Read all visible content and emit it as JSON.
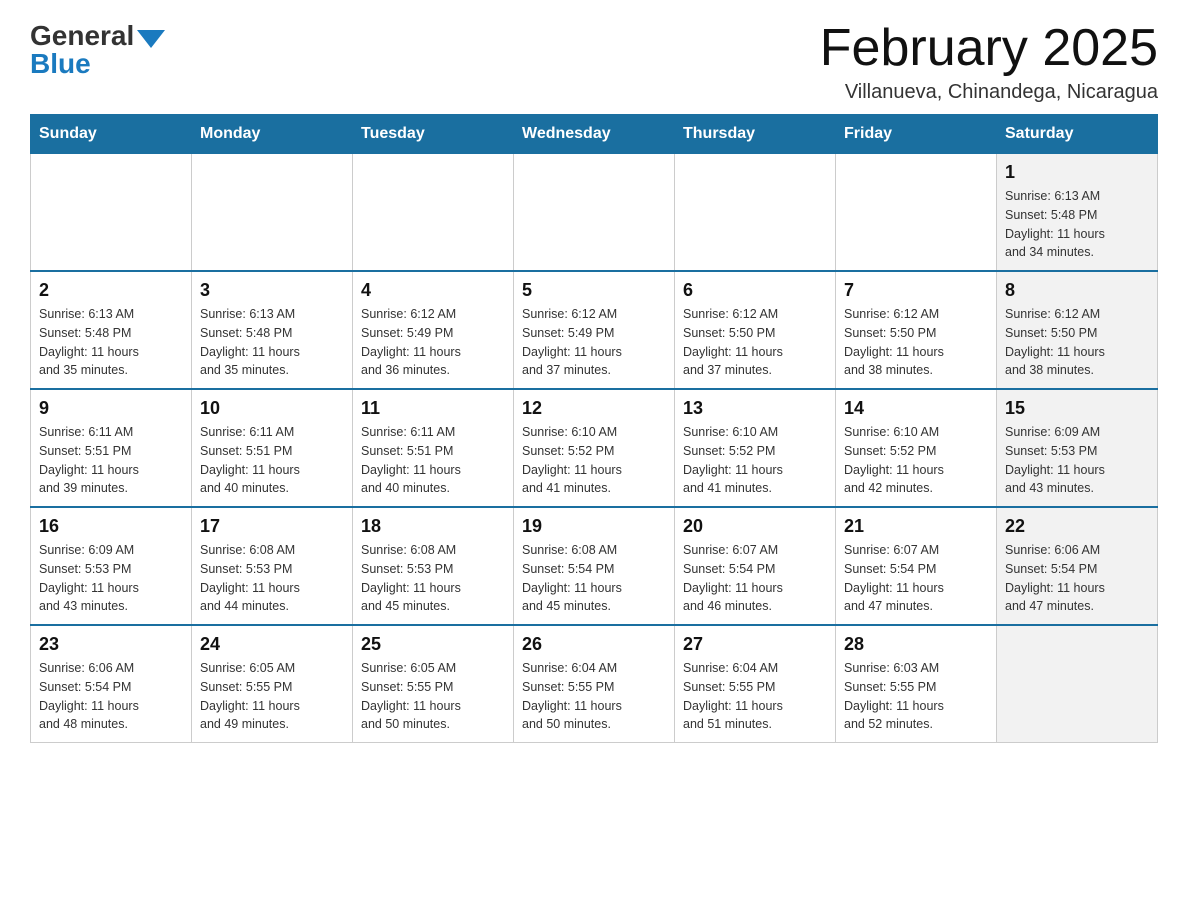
{
  "header": {
    "logo_general": "General",
    "logo_blue": "Blue",
    "title": "February 2025",
    "subtitle": "Villanueva, Chinandega, Nicaragua"
  },
  "days_of_week": [
    "Sunday",
    "Monday",
    "Tuesday",
    "Wednesday",
    "Thursday",
    "Friday",
    "Saturday"
  ],
  "weeks": [
    [
      {
        "day": "",
        "info": ""
      },
      {
        "day": "",
        "info": ""
      },
      {
        "day": "",
        "info": ""
      },
      {
        "day": "",
        "info": ""
      },
      {
        "day": "",
        "info": ""
      },
      {
        "day": "",
        "info": ""
      },
      {
        "day": "1",
        "info": "Sunrise: 6:13 AM\nSunset: 5:48 PM\nDaylight: 11 hours\nand 34 minutes.",
        "shaded": true
      }
    ],
    [
      {
        "day": "2",
        "info": "Sunrise: 6:13 AM\nSunset: 5:48 PM\nDaylight: 11 hours\nand 35 minutes."
      },
      {
        "day": "3",
        "info": "Sunrise: 6:13 AM\nSunset: 5:48 PM\nDaylight: 11 hours\nand 35 minutes."
      },
      {
        "day": "4",
        "info": "Sunrise: 6:12 AM\nSunset: 5:49 PM\nDaylight: 11 hours\nand 36 minutes."
      },
      {
        "day": "5",
        "info": "Sunrise: 6:12 AM\nSunset: 5:49 PM\nDaylight: 11 hours\nand 37 minutes."
      },
      {
        "day": "6",
        "info": "Sunrise: 6:12 AM\nSunset: 5:50 PM\nDaylight: 11 hours\nand 37 minutes."
      },
      {
        "day": "7",
        "info": "Sunrise: 6:12 AM\nSunset: 5:50 PM\nDaylight: 11 hours\nand 38 minutes."
      },
      {
        "day": "8",
        "info": "Sunrise: 6:12 AM\nSunset: 5:50 PM\nDaylight: 11 hours\nand 38 minutes.",
        "shaded": true
      }
    ],
    [
      {
        "day": "9",
        "info": "Sunrise: 6:11 AM\nSunset: 5:51 PM\nDaylight: 11 hours\nand 39 minutes."
      },
      {
        "day": "10",
        "info": "Sunrise: 6:11 AM\nSunset: 5:51 PM\nDaylight: 11 hours\nand 40 minutes."
      },
      {
        "day": "11",
        "info": "Sunrise: 6:11 AM\nSunset: 5:51 PM\nDaylight: 11 hours\nand 40 minutes."
      },
      {
        "day": "12",
        "info": "Sunrise: 6:10 AM\nSunset: 5:52 PM\nDaylight: 11 hours\nand 41 minutes."
      },
      {
        "day": "13",
        "info": "Sunrise: 6:10 AM\nSunset: 5:52 PM\nDaylight: 11 hours\nand 41 minutes."
      },
      {
        "day": "14",
        "info": "Sunrise: 6:10 AM\nSunset: 5:52 PM\nDaylight: 11 hours\nand 42 minutes."
      },
      {
        "day": "15",
        "info": "Sunrise: 6:09 AM\nSunset: 5:53 PM\nDaylight: 11 hours\nand 43 minutes.",
        "shaded": true
      }
    ],
    [
      {
        "day": "16",
        "info": "Sunrise: 6:09 AM\nSunset: 5:53 PM\nDaylight: 11 hours\nand 43 minutes."
      },
      {
        "day": "17",
        "info": "Sunrise: 6:08 AM\nSunset: 5:53 PM\nDaylight: 11 hours\nand 44 minutes."
      },
      {
        "day": "18",
        "info": "Sunrise: 6:08 AM\nSunset: 5:53 PM\nDaylight: 11 hours\nand 45 minutes."
      },
      {
        "day": "19",
        "info": "Sunrise: 6:08 AM\nSunset: 5:54 PM\nDaylight: 11 hours\nand 45 minutes."
      },
      {
        "day": "20",
        "info": "Sunrise: 6:07 AM\nSunset: 5:54 PM\nDaylight: 11 hours\nand 46 minutes."
      },
      {
        "day": "21",
        "info": "Sunrise: 6:07 AM\nSunset: 5:54 PM\nDaylight: 11 hours\nand 47 minutes."
      },
      {
        "day": "22",
        "info": "Sunrise: 6:06 AM\nSunset: 5:54 PM\nDaylight: 11 hours\nand 47 minutes.",
        "shaded": true
      }
    ],
    [
      {
        "day": "23",
        "info": "Sunrise: 6:06 AM\nSunset: 5:54 PM\nDaylight: 11 hours\nand 48 minutes."
      },
      {
        "day": "24",
        "info": "Sunrise: 6:05 AM\nSunset: 5:55 PM\nDaylight: 11 hours\nand 49 minutes."
      },
      {
        "day": "25",
        "info": "Sunrise: 6:05 AM\nSunset: 5:55 PM\nDaylight: 11 hours\nand 50 minutes."
      },
      {
        "day": "26",
        "info": "Sunrise: 6:04 AM\nSunset: 5:55 PM\nDaylight: 11 hours\nand 50 minutes."
      },
      {
        "day": "27",
        "info": "Sunrise: 6:04 AM\nSunset: 5:55 PM\nDaylight: 11 hours\nand 51 minutes."
      },
      {
        "day": "28",
        "info": "Sunrise: 6:03 AM\nSunset: 5:55 PM\nDaylight: 11 hours\nand 52 minutes."
      },
      {
        "day": "",
        "info": "",
        "shaded": true
      }
    ]
  ]
}
